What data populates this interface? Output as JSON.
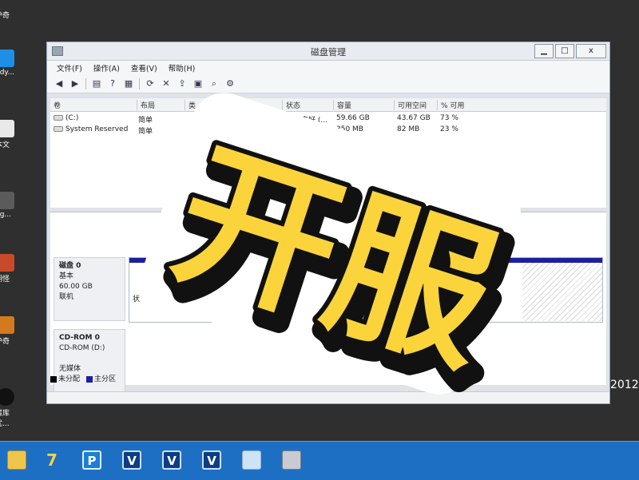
{
  "desktop": {
    "icons": [
      {
        "name": "desktop-icon-1",
        "label": "护奇",
        "color": "#3a7bd5"
      },
      {
        "name": "desktop-icon-2",
        "label": "ndy...",
        "color": "#1d8fe6"
      },
      {
        "name": "desktop-icon-3",
        "label": "本文",
        "color": "#e9e9e9"
      },
      {
        "name": "desktop-icon-4",
        "label": "ng...",
        "color": "#5b5b5b"
      },
      {
        "name": "desktop-icon-5",
        "label": "期怪",
        "color": "#c74b2a"
      },
      {
        "name": "desktop-icon-6",
        "label": "护奇",
        "color": "#d47a1e"
      },
      {
        "name": "desktop-icon-7",
        "label": "腐库",
        "color": "#111111"
      },
      {
        "name": "desktop-icon-8",
        "label": "优...",
        "color": "#2f2f2f"
      }
    ],
    "year_fragment": "2012"
  },
  "window": {
    "title": "磁盘管理",
    "controls": {
      "minimize": "▁",
      "maximize": "□",
      "close": "x"
    },
    "menu": [
      "文件(F)",
      "操作(A)",
      "查看(V)",
      "帮助(H)"
    ],
    "toolbar_icons": [
      "back-arrow-icon",
      "forward-arrow-icon",
      "list-view-icon",
      "help-icon",
      "properties-icon",
      "refresh-icon",
      "delete-icon",
      "export-icon",
      "open-icon",
      "search-icon",
      "settings-icon"
    ]
  },
  "volume_table": {
    "columns": [
      "卷",
      "布局",
      "类",
      "状态",
      "容量",
      "可用空间",
      "% 可用"
    ],
    "rows": [
      {
        "volume": "(C:)",
        "layout": "简单",
        "status": "状态良好 (...",
        "capacity": "59.66 GB",
        "free": "43.67 GB",
        "pct": "73 %"
      },
      {
        "volume": "System Reserved",
        "layout": "简单",
        "status": "状态良好 (...",
        "capacity": "350 MB",
        "free": "82 MB",
        "pct": "23 %"
      }
    ]
  },
  "disks": [
    {
      "name": "磁盘 0",
      "type": "基本",
      "size": "60.00 GB",
      "state": "联机",
      "partition_text": "状"
    },
    {
      "name": "CD-ROM 0",
      "type": "CD-ROM (D:)",
      "size": "",
      "state": "无媒体"
    }
  ],
  "legend": [
    {
      "label": "未分配",
      "color": "#000000"
    },
    {
      "label": "主分区",
      "color": "#1b1fa0"
    }
  ],
  "overlay": {
    "text": "开服",
    "fill": "#fbd43c",
    "outline": "#111111",
    "sticker_bg": "#ffffff"
  },
  "taskbar": {
    "color": "#1d6fc4",
    "items": [
      {
        "name": "taskbar-file-explorer",
        "glyph": ""
      },
      {
        "name": "taskbar-app-7",
        "glyph": "7"
      },
      {
        "name": "taskbar-app-p",
        "glyph": "P"
      },
      {
        "name": "taskbar-app-v1",
        "glyph": "V"
      },
      {
        "name": "taskbar-app-v2",
        "glyph": "V"
      },
      {
        "name": "taskbar-app-v3",
        "glyph": "V"
      },
      {
        "name": "taskbar-app-doc",
        "glyph": ""
      },
      {
        "name": "taskbar-app-printer",
        "glyph": ""
      }
    ]
  }
}
